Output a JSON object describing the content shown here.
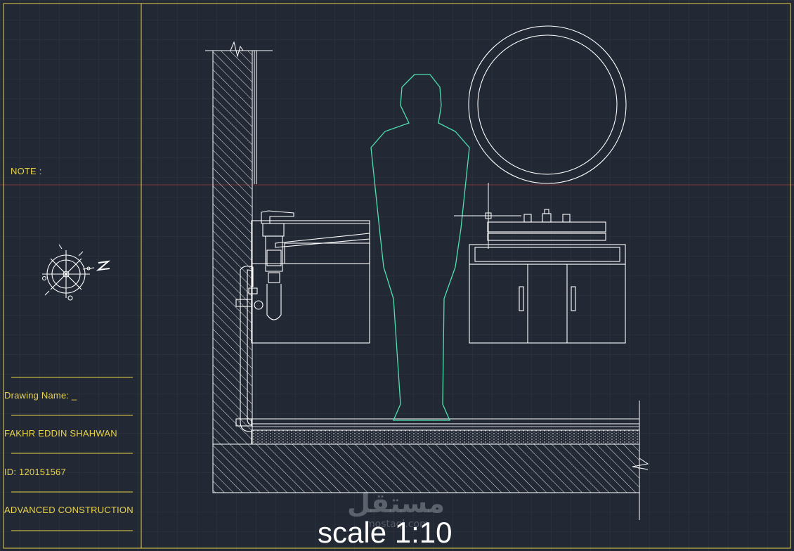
{
  "title_block": {
    "note_label": "NOTE :",
    "drawing_name": "Drawing Name: _",
    "author": "FAKHR EDDIN SHAHWAN",
    "id_line": "ID: 120151567",
    "course": "ADVANCED CONSTRUCTION"
  },
  "compass": {
    "letter": "Z",
    "icon": "north-arrow-icon"
  },
  "scale_label": "scale 1:10",
  "watermark": {
    "text": "مستقل",
    "sub": "mostaql.com"
  },
  "colors": {
    "background": "#222834",
    "grid": "#2f3744",
    "border": "#e8d24a",
    "linework": "#ffffff",
    "human_figure": "#4fe0b0",
    "crosshair": "#a33a3a"
  }
}
